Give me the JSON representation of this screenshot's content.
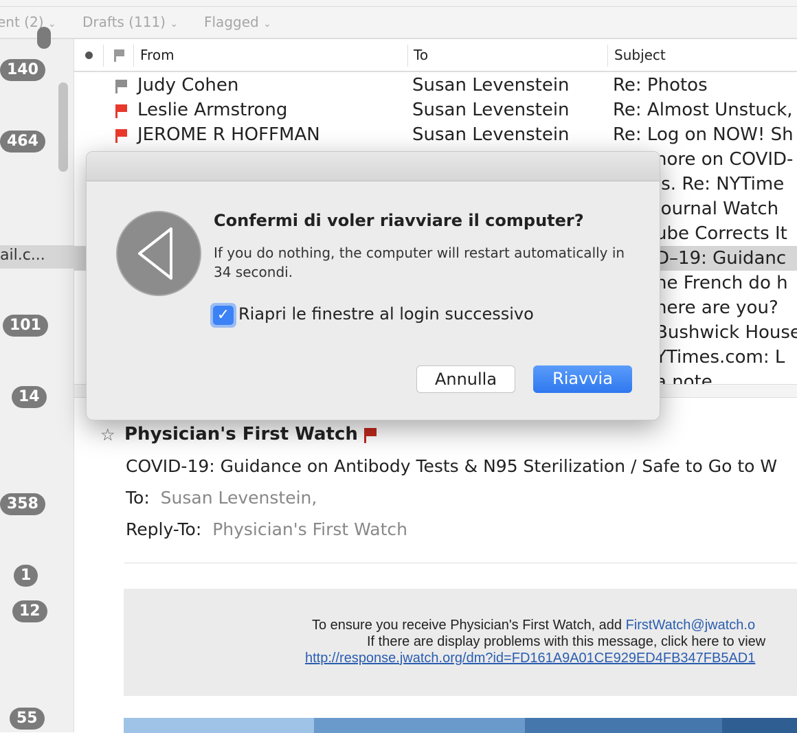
{
  "favorites_bar": [
    {
      "label": "ent (2)"
    },
    {
      "label": "Drafts (111)"
    },
    {
      "label": "Flagged"
    }
  ],
  "sidebar": {
    "badges": [
      "140",
      "464",
      "101",
      "14",
      "358",
      "1",
      "12",
      "55"
    ],
    "account_label": "ail.c..."
  },
  "list": {
    "columns": {
      "from": "From",
      "to": "To",
      "subject": "Subject"
    },
    "rows": [
      {
        "from": "Judy Cohen",
        "to": "Susan Levenstein",
        "subject": "Re: Photos",
        "flag": "gray"
      },
      {
        "from": "Leslie Armstrong",
        "to": "Susan Levenstein",
        "subject": "Re: Almost Unstuck,",
        "flag": "red"
      },
      {
        "from": "JEROME R HOFFMAN",
        "to": "Susan Levenstein",
        "subject": "Re: Log on NOW! Sh",
        "flag": "red"
      }
    ],
    "hidden_rows_subject_fragments": [
      "nore on COVID-",
      ".s. Re: NYTime",
      " Journal Watch",
      "ube Corrects It",
      "D–19: Guidanc",
      "he French do h",
      "here are you?",
      "Bushwick House",
      "YTimes.com: L",
      "a note"
    ]
  },
  "dialog": {
    "title": "Confermi di voler riavviare il computer?",
    "body": "If you do nothing, the computer will restart automatically in 34 secondi.",
    "checkbox_label": "Riapri le finestre al login successivo",
    "checkbox_checked": true,
    "cancel": "Annulla",
    "confirm": "Riavvia",
    "accent": "#3b82f6"
  },
  "preview": {
    "sender": "Physician's First Watch",
    "subject": "COVID-19: Guidance on Antibody Tests & N95 Sterilization / Safe to Go to W",
    "to_label": "To:",
    "to_value": "Susan Levenstein,",
    "replyto_label": "Reply-To:",
    "replyto_value": "Physician's First Watch",
    "notice_line1_text": "To ensure you receive Physician's First Watch, add ",
    "notice_line1_link": "FirstWatch@jwatch.o",
    "notice_line2": "If there are display problems with this message, click here to view",
    "notice_url": "http://response.jwatch.org/dm?id=FD161A9A01CE929ED4FB347FB5AD1"
  }
}
